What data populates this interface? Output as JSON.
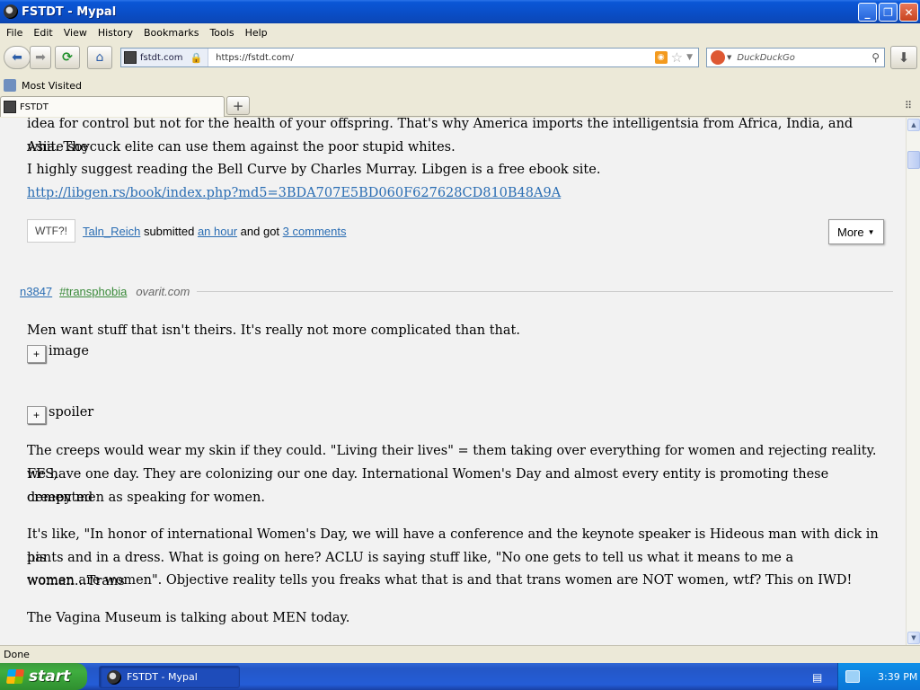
{
  "window": {
    "title": "FSTDT - Mypal"
  },
  "menu": [
    "File",
    "Edit",
    "View",
    "History",
    "Bookmarks",
    "Tools",
    "Help"
  ],
  "nav": {
    "site_identity": "fstdt.com",
    "url": "https://fstdt.com/",
    "search_placeholder": "DuckDuckGo"
  },
  "bookmarks": {
    "most_visited": "Most Visited"
  },
  "tabs": [
    {
      "label": "FSTDT",
      "active": true
    }
  ],
  "content": {
    "prev_post": {
      "text_line1": "idea for control but not for the health of your offspring. That's why America imports the intelligentsia from Africa, India, and Asia. The",
      "text_line2": "white soycuck elite can use them against the poor stupid whites.",
      "text_line3": "I highly suggest reading the Bell Curve by Charles Murray. Libgen is a free ebook site.",
      "link": "http://libgen.rs/book/index.php?md5=3BDA707E5BD060F627628CD810B48A9A",
      "badge": "WTF?!",
      "submitter": "Taln_Reich",
      "submitted_word": "submitted",
      "time_ago": "an hour",
      "and_got": "and got",
      "comments": "3 comments",
      "more_label": "More"
    },
    "post": {
      "id": "n3847",
      "tag": "#transphobia",
      "source": "ovarit.com",
      "intro": "Men want stuff that isn't theirs. It's really not more complicated than that.",
      "expand_image_label": "image",
      "expand_spoiler_label": "spoiler",
      "para1_line1": "The creeps would wear my skin if they could. \"Living their lives\" = them taking over everything for women and rejecting reality. FFS,",
      "para1_line2": "we have one day. They are colonizing our one day. International Women's Day and almost every entity is promoting these demented",
      "para1_line3": "creepy men as speaking for women.",
      "para2_line1": "It's like, \"In honor of international Women's Day, we will have a conference and the keynote speaker is Hideous man with dick in his",
      "para2_line2": "pants and in a dress. What is going on here? ACLU is saying stuff like, \"No one gets to tell us what it means to me a woman...Trans",
      "para2_line3": "women are women\". Objective reality tells you freaks what that is and that trans women are NOT women, wtf? This on IWD!",
      "para3": "The Vagina Museum is talking about MEN today."
    }
  },
  "status": "Done",
  "taskbar": {
    "start_label": "start",
    "task_label": "FSTDT - Mypal",
    "clock": "3:39 PM"
  }
}
